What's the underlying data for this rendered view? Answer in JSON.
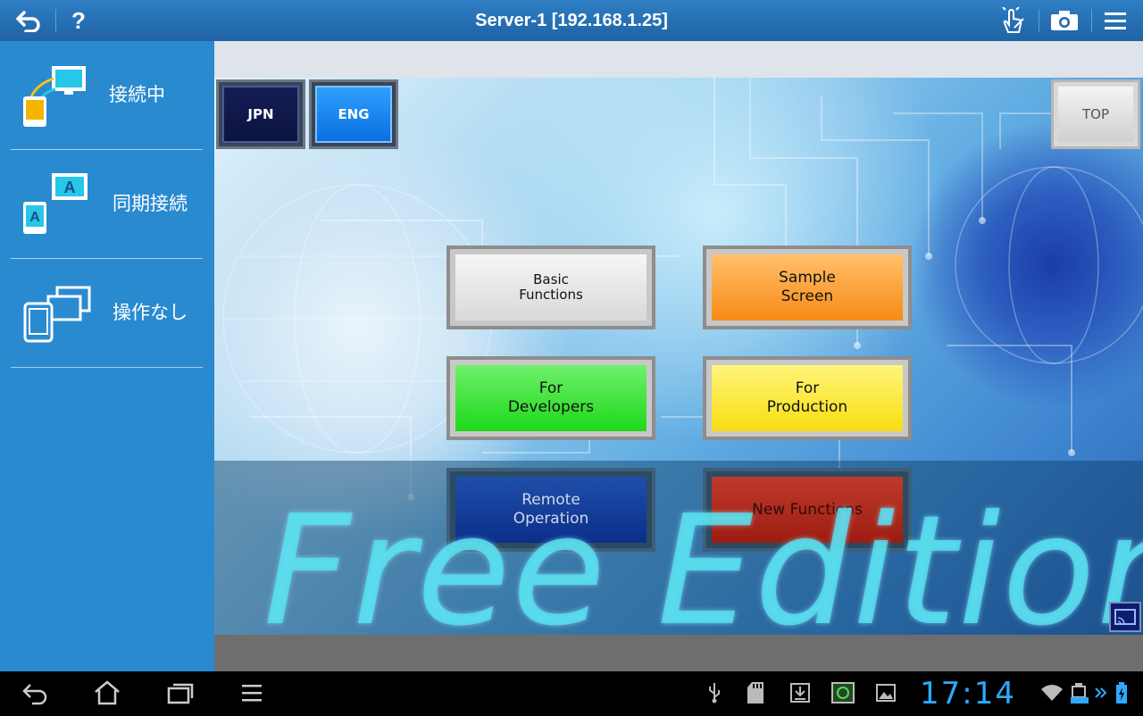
{
  "topbar": {
    "title": "Server-1 [192.168.1.25]",
    "back_icon": "back-arrow-icon",
    "help_label": "?",
    "touch_icon": "hand-touch-icon",
    "camera_icon": "camera-icon",
    "menu_icon": "overflow-menu-icon"
  },
  "sidebar": {
    "items": [
      {
        "label": "接続中",
        "icon": "connected-devices-icon"
      },
      {
        "label": "同期接続",
        "icon": "sync-connection-icon"
      },
      {
        "label": "操作なし",
        "icon": "no-operation-icon"
      }
    ]
  },
  "hmi": {
    "lang_jpn": "JPN",
    "lang_eng": "ENG",
    "top_label": "TOP",
    "buttons": [
      {
        "label": "Basic\nFunctions",
        "color": "#d9d9d9"
      },
      {
        "label": "Sample\nScreen",
        "color": "#f88a16"
      },
      {
        "label": "For\nDevelopers",
        "color": "#1ed81a"
      },
      {
        "label": "For\nProduction",
        "color": "#f7de10"
      },
      {
        "label": "Remote\nOperation",
        "color": "#0a2f8a"
      },
      {
        "label": "New Functions",
        "color": "#9d1c12"
      }
    ],
    "watermark": "Free Edition",
    "cast_icon": "cast-screen-icon"
  },
  "navbar": {
    "back_icon": "nav-back-icon",
    "home_icon": "nav-home-icon",
    "recents_icon": "nav-recents-icon",
    "menu_icon": "nav-menu-icon",
    "status_icons": [
      "usb-icon",
      "sd-card-icon",
      "download-icon",
      "screenshot-icon",
      "gallery-icon",
      "wifi-icon",
      "keyboard-battery-icon",
      "chevron-icon",
      "battery-charging-icon"
    ],
    "clock": "17:14"
  }
}
